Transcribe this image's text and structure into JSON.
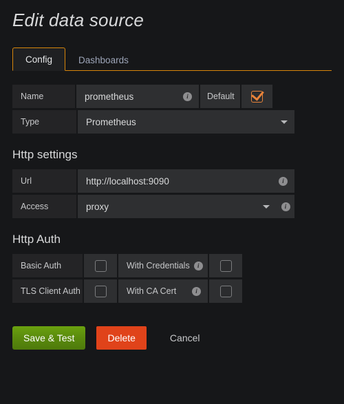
{
  "page": {
    "title": "Edit data source"
  },
  "tabs": [
    {
      "label": "Config",
      "active": true
    },
    {
      "label": "Dashboards",
      "active": false
    }
  ],
  "settings": {
    "name": {
      "label": "Name",
      "value": "prometheus",
      "info": "i",
      "default_label": "Default",
      "default_checked": true
    },
    "type": {
      "label": "Type",
      "value": "Prometheus"
    }
  },
  "http_settings": {
    "heading": "Http settings",
    "url": {
      "label": "Url",
      "value": "http://localhost:9090",
      "info": "i"
    },
    "access": {
      "label": "Access",
      "value": "proxy",
      "info": "i"
    }
  },
  "http_auth": {
    "heading": "Http Auth",
    "rows": [
      {
        "label": "Basic Auth",
        "checked": false,
        "mid_label": "With Credentials",
        "mid_info": "i",
        "mid_checked": false
      },
      {
        "label": "TLS Client Auth",
        "checked": false,
        "mid_label": "With CA Cert",
        "mid_info": "i",
        "mid_checked": false
      }
    ]
  },
  "actions": {
    "save": "Save & Test",
    "delete": "Delete",
    "cancel": "Cancel"
  },
  "colors": {
    "accent": "#d8860b",
    "checkbox_checked": "#e8833a",
    "save": "#5a8a0d",
    "delete": "#e0431a",
    "background": "#161719"
  }
}
